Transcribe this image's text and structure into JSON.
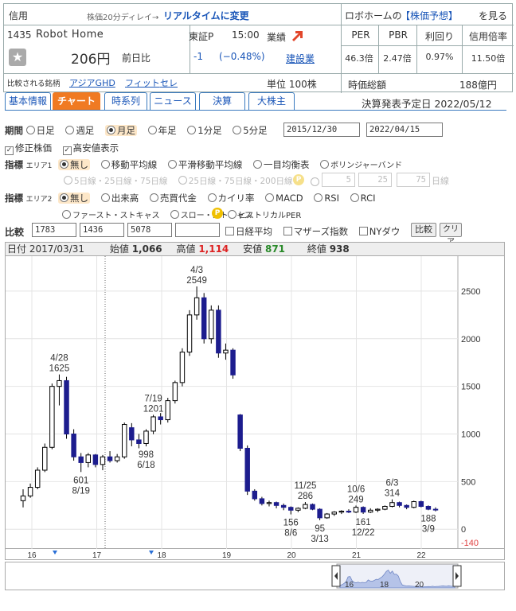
{
  "header": {
    "market_label": "信用",
    "delay_note": "株価20分ディレイ→",
    "realtime_link": "リアルタイムに変更",
    "robo_prefix": "ロボホームの",
    "robo_link": "【株価予想】",
    "robo_suffix": "を見る",
    "code": "1435",
    "name": "Robot Home",
    "exchange": "東証P",
    "time": "15:00",
    "price": "206円",
    "change_label": "前日比",
    "change": "-1",
    "change_pct": "(−0.48%)",
    "compare_label": "比較される銘柄",
    "compare_links": [
      "アジアGHD",
      "フィット",
      "セレ"
    ],
    "gyoseki_label": "業績",
    "industry": "建設業",
    "unit": "単位 100株",
    "per_label": "PER",
    "pbr_label": "PBR",
    "yield_label": "利回り",
    "margin_label": "信用倍率",
    "per": "46.3倍",
    "pbr": "2.47倍",
    "yield": "0.97%",
    "margin": "11.50倍",
    "mcap_label": "時価総額",
    "mcap": "188億円"
  },
  "tabs": [
    "基本情報",
    "チャート",
    "時系列",
    "ニュース",
    "決算",
    "大株主"
  ],
  "earnings_date": "決算発表予定日  2022/05/12",
  "period": {
    "label": "期間",
    "options": [
      "日足",
      "週足",
      "月足",
      "年足",
      "1分足",
      "5分足"
    ],
    "selected": "月足",
    "from": "2015/12/30",
    "to": "2022/04/15"
  },
  "checks": [
    "修正株価",
    "高安値表示"
  ],
  "indicators1": {
    "label": "指標",
    "area": "エリア1",
    "options": [
      "無し",
      "移動平均線",
      "平滑移動平均線",
      "一目均衡表",
      "ボリンジャーバンド"
    ],
    "selected": "無し",
    "sub_a": "5日線・25日線・75日線",
    "sub_b": "25日線・75日線・200日線",
    "ma_values": [
      "5",
      "25",
      "75"
    ],
    "unit": "日線"
  },
  "indicators2": {
    "label": "指標",
    "area": "エリア2",
    "options": [
      "無し",
      "出来高",
      "売買代金",
      "カイリ率",
      "MACD",
      "RSI",
      "RCI"
    ],
    "options2": [
      "ファースト・ストキャス",
      "スロー・ストキャス",
      "ヒストリカルPER"
    ],
    "selected": "無し"
  },
  "compare": {
    "label": "比較",
    "codes": [
      "1783",
      "1436",
      "5078",
      ""
    ],
    "options": [
      "日経平均",
      "マザーズ指数",
      "NYダウ"
    ],
    "btn_compare": "比較",
    "btn_clear": "クリア"
  },
  "ohlc_bar": {
    "date_label": "日付",
    "date": "2017/03/31",
    "open_label": "始値",
    "open": "1,066",
    "high_label": "高値",
    "high": "1,114",
    "low_label": "安値",
    "low": "871",
    "close_label": "終値",
    "close": "938"
  },
  "chart_data": {
    "type": "candlestick",
    "ylim": [
      -140,
      2800
    ],
    "yticks": [
      0,
      500,
      1000,
      1500,
      2000,
      2500
    ],
    "ymin_label": "-140",
    "xticks": [
      "16",
      "17",
      "18",
      "19",
      "20",
      "21",
      "22"
    ],
    "annotations": [
      {
        "date": "4/28",
        "value": "1625"
      },
      {
        "date": "8/19",
        "value": "601"
      },
      {
        "date": "7/19",
        "value": "1201"
      },
      {
        "date": "6/18",
        "value": "998"
      },
      {
        "date": "4/3",
        "value": "2549"
      },
      {
        "date": "8/6",
        "value": "156"
      },
      {
        "date": "11/25",
        "value": "286"
      },
      {
        "date": "3/13",
        "value": "95"
      },
      {
        "date": "12/22",
        "value": "161"
      },
      {
        "date": "10/6",
        "value": "249"
      },
      {
        "date": "6/3",
        "value": "314"
      },
      {
        "date": "3/9",
        "value": "188"
      }
    ],
    "candles": [
      {
        "o": 300,
        "h": 420,
        "l": 230,
        "c": 350
      },
      {
        "o": 350,
        "h": 480,
        "l": 330,
        "c": 440
      },
      {
        "o": 440,
        "h": 650,
        "l": 420,
        "c": 620
      },
      {
        "o": 620,
        "h": 900,
        "l": 600,
        "c": 860
      },
      {
        "o": 860,
        "h": 1530,
        "l": 840,
        "c": 1500
      },
      {
        "o": 1500,
        "h": 1625,
        "l": 1300,
        "c": 1560
      },
      {
        "o": 1560,
        "h": 1600,
        "l": 950,
        "c": 1000
      },
      {
        "o": 1000,
        "h": 1050,
        "l": 720,
        "c": 760
      },
      {
        "o": 760,
        "h": 800,
        "l": 601,
        "c": 700
      },
      {
        "o": 700,
        "h": 800,
        "l": 650,
        "c": 780
      },
      {
        "o": 780,
        "h": 790,
        "l": 650,
        "c": 680
      },
      {
        "o": 680,
        "h": 780,
        "l": 620,
        "c": 760
      },
      {
        "o": 760,
        "h": 820,
        "l": 700,
        "c": 720
      },
      {
        "o": 720,
        "h": 790,
        "l": 700,
        "c": 760
      },
      {
        "o": 760,
        "h": 1120,
        "l": 740,
        "c": 1100
      },
      {
        "o": 1066,
        "h": 1114,
        "l": 871,
        "c": 938
      },
      {
        "o": 938,
        "h": 1000,
        "l": 850,
        "c": 900
      },
      {
        "o": 900,
        "h": 1050,
        "l": 870,
        "c": 1030
      },
      {
        "o": 1030,
        "h": 1201,
        "l": 998,
        "c": 1180
      },
      {
        "o": 1180,
        "h": 1220,
        "l": 1100,
        "c": 1150
      },
      {
        "o": 1150,
        "h": 1380,
        "l": 1120,
        "c": 1350
      },
      {
        "o": 1350,
        "h": 1560,
        "l": 1320,
        "c": 1540
      },
      {
        "o": 1540,
        "h": 1900,
        "l": 1500,
        "c": 1860
      },
      {
        "o": 1860,
        "h": 2300,
        "l": 1820,
        "c": 2250
      },
      {
        "o": 2250,
        "h": 2549,
        "l": 2200,
        "c": 2430
      },
      {
        "o": 2430,
        "h": 2480,
        "l": 1950,
        "c": 2000
      },
      {
        "o": 2000,
        "h": 2350,
        "l": 1950,
        "c": 2300
      },
      {
        "o": 2300,
        "h": 2350,
        "l": 1800,
        "c": 1850
      },
      {
        "o": 1850,
        "h": 1950,
        "l": 1780,
        "c": 1880
      },
      {
        "o": 1880,
        "h": 1900,
        "l": 1580,
        "c": 1620
      },
      {
        "o": 1200,
        "h": 1210,
        "l": 820,
        "c": 850
      },
      {
        "o": 850,
        "h": 880,
        "l": 360,
        "c": 400
      },
      {
        "o": 400,
        "h": 420,
        "l": 300,
        "c": 320
      },
      {
        "o": 320,
        "h": 340,
        "l": 250,
        "c": 270
      },
      {
        "o": 270,
        "h": 300,
        "l": 240,
        "c": 280
      },
      {
        "o": 280,
        "h": 290,
        "l": 220,
        "c": 250
      },
      {
        "o": 250,
        "h": 270,
        "l": 200,
        "c": 230
      },
      {
        "o": 230,
        "h": 240,
        "l": 156,
        "c": 200
      },
      {
        "o": 200,
        "h": 230,
        "l": 180,
        "c": 220
      },
      {
        "o": 220,
        "h": 286,
        "l": 210,
        "c": 260
      },
      {
        "o": 260,
        "h": 270,
        "l": 200,
        "c": 210
      },
      {
        "o": 210,
        "h": 220,
        "l": 95,
        "c": 120
      },
      {
        "o": 120,
        "h": 170,
        "l": 110,
        "c": 160
      },
      {
        "o": 160,
        "h": 190,
        "l": 140,
        "c": 180
      },
      {
        "o": 180,
        "h": 200,
        "l": 160,
        "c": 190
      },
      {
        "o": 190,
        "h": 210,
        "l": 170,
        "c": 180
      },
      {
        "o": 180,
        "h": 249,
        "l": 170,
        "c": 230
      },
      {
        "o": 230,
        "h": 240,
        "l": 161,
        "c": 180
      },
      {
        "o": 180,
        "h": 220,
        "l": 170,
        "c": 200
      },
      {
        "o": 200,
        "h": 220,
        "l": 180,
        "c": 210
      },
      {
        "o": 210,
        "h": 250,
        "l": 200,
        "c": 240
      },
      {
        "o": 240,
        "h": 314,
        "l": 230,
        "c": 280
      },
      {
        "o": 280,
        "h": 290,
        "l": 230,
        "c": 250
      },
      {
        "o": 250,
        "h": 260,
        "l": 210,
        "c": 230
      },
      {
        "o": 230,
        "h": 300,
        "l": 220,
        "c": 290
      },
      {
        "o": 290,
        "h": 300,
        "l": 230,
        "c": 240
      },
      {
        "o": 240,
        "h": 250,
        "l": 200,
        "c": 210
      },
      {
        "o": 210,
        "h": 230,
        "l": 188,
        "c": 206
      }
    ]
  },
  "navigator": {
    "ticks": [
      "16",
      "18",
      "20"
    ]
  }
}
